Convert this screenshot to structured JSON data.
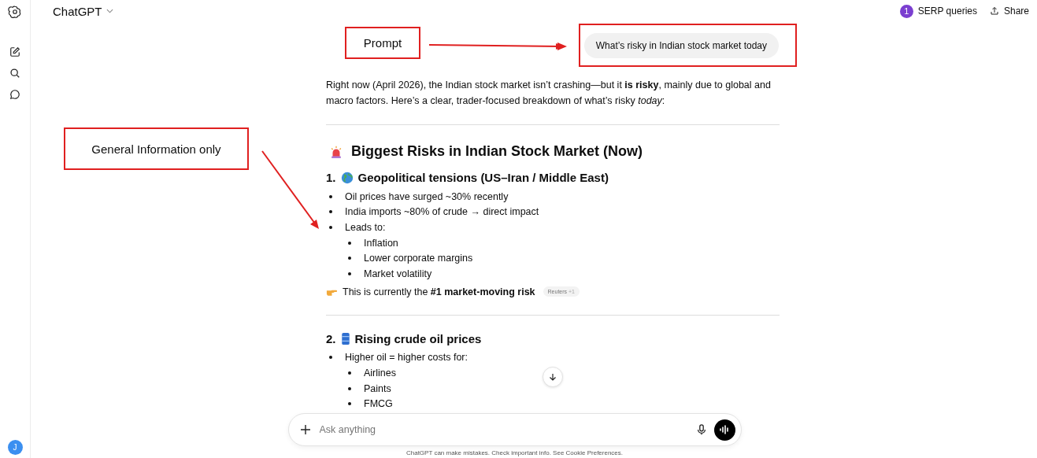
{
  "header": {
    "title": "ChatGPT",
    "badge_count": "1",
    "badge_label": "SERP queries",
    "share": "Share"
  },
  "user_message": "What’s risky in Indian stock market today",
  "response": {
    "intro": "Right now (April 2026), the Indian stock market isn’t crashing—but it **is risky**, mainly due to global and macro factors. Here’s a clear, trader-focused breakdown of what’s risky *today*:",
    "heading": "Biggest Risks in Indian Stock Market (Now)",
    "sections": [
      {
        "number": "1.",
        "kind": "globe",
        "title": "Geopolitical tensions (US–Iran / Middle East)",
        "bullets": [
          {
            "text": "Oil prices have surged ~30% recently"
          },
          {
            "text": "India imports ~80% of crude → direct impact"
          },
          {
            "text": "Leads to:",
            "children": [
              {
                "text": "Inflation"
              },
              {
                "text": "Lower corporate margins"
              },
              {
                "text": "Market volatility"
              }
            ]
          }
        ],
        "note": {
          "text": "This is currently the **#1 market-moving risk**",
          "source": "Reuters",
          "extra": "+1"
        }
      },
      {
        "number": "2.",
        "kind": "barrel",
        "title": "Rising crude oil prices",
        "bullets": [
          {
            "text": "Higher oil = higher costs for:",
            "children": [
              {
                "text": "Airlines"
              },
              {
                "text": "Paints"
              },
              {
                "text": "FMCG"
              }
            ]
          }
        ]
      }
    ]
  },
  "composer": {
    "placeholder": "Ask anything"
  },
  "disclaimer": "ChatGPT can make mistakes. Check important info. See Cookie Preferences.",
  "user_avatar": "J",
  "annotations": [
    {
      "label": "Prompt"
    },
    {
      "label": "General Information only"
    }
  ]
}
